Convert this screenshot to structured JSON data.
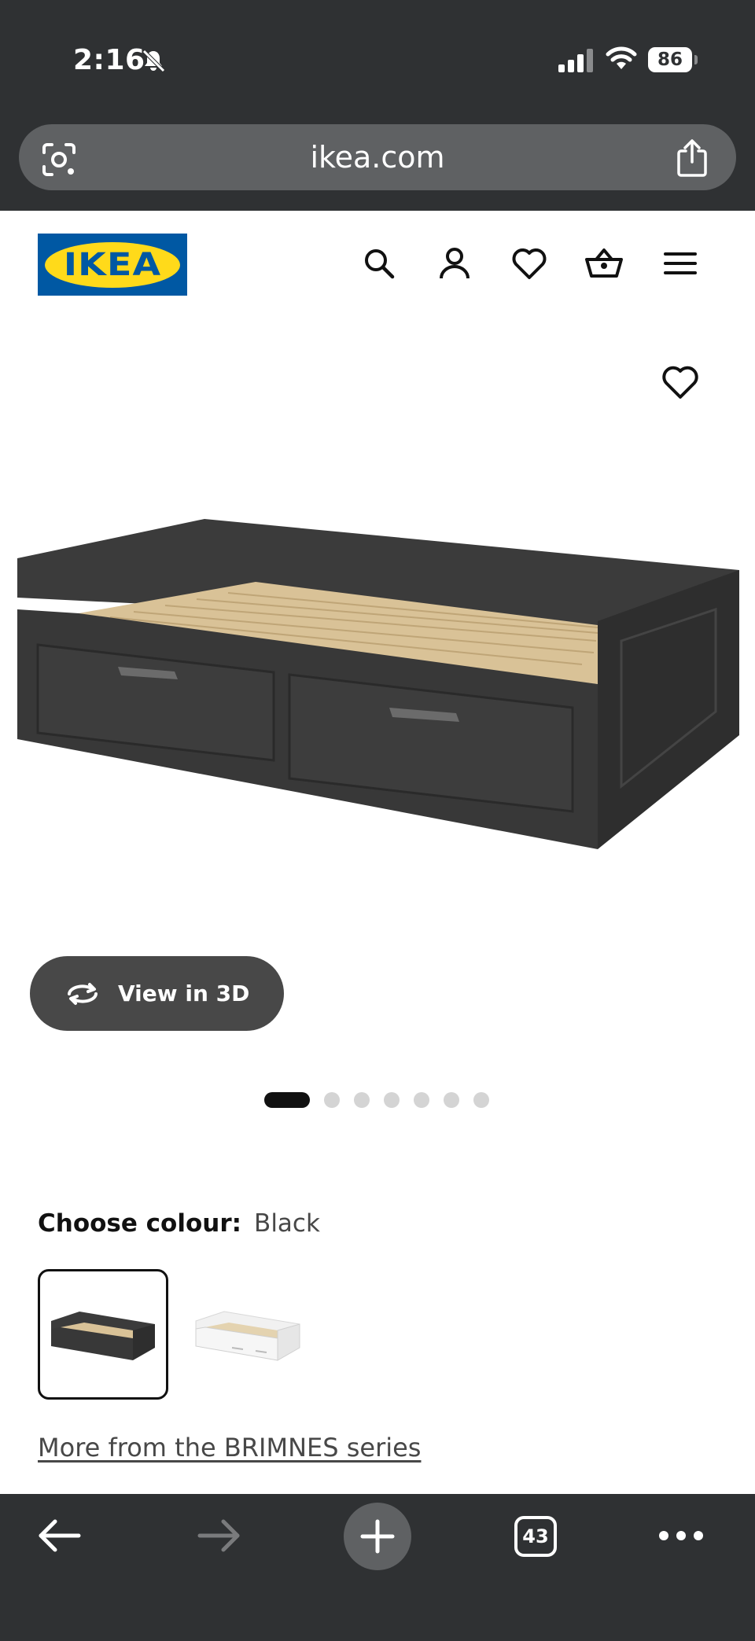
{
  "status_bar": {
    "time": "2:16",
    "battery": "86"
  },
  "browser": {
    "url": "ikea.com",
    "tab_count": "43"
  },
  "header": {
    "logo": "IKEA",
    "icons": [
      "search-icon",
      "account-icon",
      "favourites-icon",
      "basket-icon",
      "menu-icon"
    ]
  },
  "gallery": {
    "view_3d_label": "View in 3D",
    "image_count": 7,
    "active_index": 0
  },
  "colour": {
    "title": "Choose colour:",
    "selected": "Black",
    "options": [
      "Black",
      "White"
    ]
  },
  "series_link": "More from the BRIMNES series",
  "colors": {
    "chrome": "#2f3133",
    "ikea_blue": "#0058a3",
    "ikea_yellow": "#ffda1a",
    "button_dark": "#484848"
  }
}
